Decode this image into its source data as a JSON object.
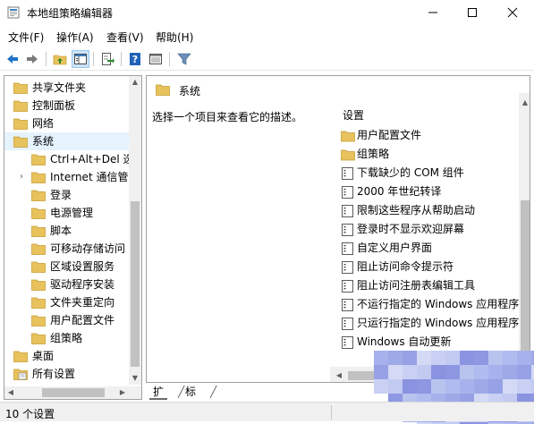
{
  "window": {
    "title": "本地组策略编辑器"
  },
  "menu": [
    {
      "label": "文件(F)"
    },
    {
      "label": "操作(A)"
    },
    {
      "label": "查看(V)"
    },
    {
      "label": "帮助(H)"
    }
  ],
  "toolbar": {
    "icons": [
      "back-arrow-icon",
      "forward-arrow-icon",
      "up-folder-icon",
      "show-hide-tree-icon",
      "export-list-icon",
      "help-icon",
      "view-options-icon",
      "filter-icon"
    ]
  },
  "tree": {
    "items": [
      {
        "label": "共享文件夹",
        "level": 0,
        "expander": ""
      },
      {
        "label": "控制面板",
        "level": 0,
        "expander": ""
      },
      {
        "label": "网络",
        "level": 0,
        "expander": ""
      },
      {
        "label": "系统",
        "level": 0,
        "expander": "",
        "selected": true
      },
      {
        "label": "Ctrl+Alt+Del 选",
        "level": 1,
        "expander": ""
      },
      {
        "label": "Internet 通信管",
        "level": 1,
        "expander": "›"
      },
      {
        "label": "登录",
        "level": 1,
        "expander": ""
      },
      {
        "label": "电源管理",
        "level": 1,
        "expander": ""
      },
      {
        "label": "脚本",
        "level": 1,
        "expander": ""
      },
      {
        "label": "可移动存储访问",
        "level": 1,
        "expander": ""
      },
      {
        "label": "区域设置服务",
        "level": 1,
        "expander": ""
      },
      {
        "label": "驱动程序安装",
        "level": 1,
        "expander": ""
      },
      {
        "label": "文件夹重定向",
        "level": 1,
        "expander": ""
      },
      {
        "label": "用户配置文件",
        "level": 1,
        "expander": ""
      },
      {
        "label": "组策略",
        "level": 1,
        "expander": ""
      },
      {
        "label": "桌面",
        "level": 0,
        "expander": ""
      },
      {
        "label": "所有设置",
        "level": 0,
        "expander": "",
        "icon": "settings"
      }
    ]
  },
  "details": {
    "header": "系统",
    "description": "选择一个项目来查看它的描述。",
    "column": "设置",
    "items": [
      {
        "label": "用户配置文件",
        "type": "folder"
      },
      {
        "label": "组策略",
        "type": "folder"
      },
      {
        "label": "下载缺少的 COM 组件",
        "type": "setting"
      },
      {
        "label": "2000 年世纪转译",
        "type": "setting"
      },
      {
        "label": "限制这些程序从帮助启动",
        "type": "setting"
      },
      {
        "label": "登录时不显示欢迎屏幕",
        "type": "setting"
      },
      {
        "label": "自定义用户界面",
        "type": "setting"
      },
      {
        "label": "阻止访问命令提示符",
        "type": "setting"
      },
      {
        "label": "阻止访问注册表编辑工具",
        "type": "setting"
      },
      {
        "label": "不运行指定的 Windows 应用程序",
        "type": "setting"
      },
      {
        "label": "只运行指定的 Windows 应用程序",
        "type": "setting"
      },
      {
        "label": "Windows 自动更新",
        "type": "setting"
      }
    ]
  },
  "tabs": [
    {
      "label": "扩展"
    },
    {
      "label": "标准"
    }
  ],
  "status": {
    "text": "10 个设置"
  },
  "colors": {
    "folder": "#e8c25c",
    "selection": "#e5f3ff",
    "accent": "#1e74c8"
  }
}
